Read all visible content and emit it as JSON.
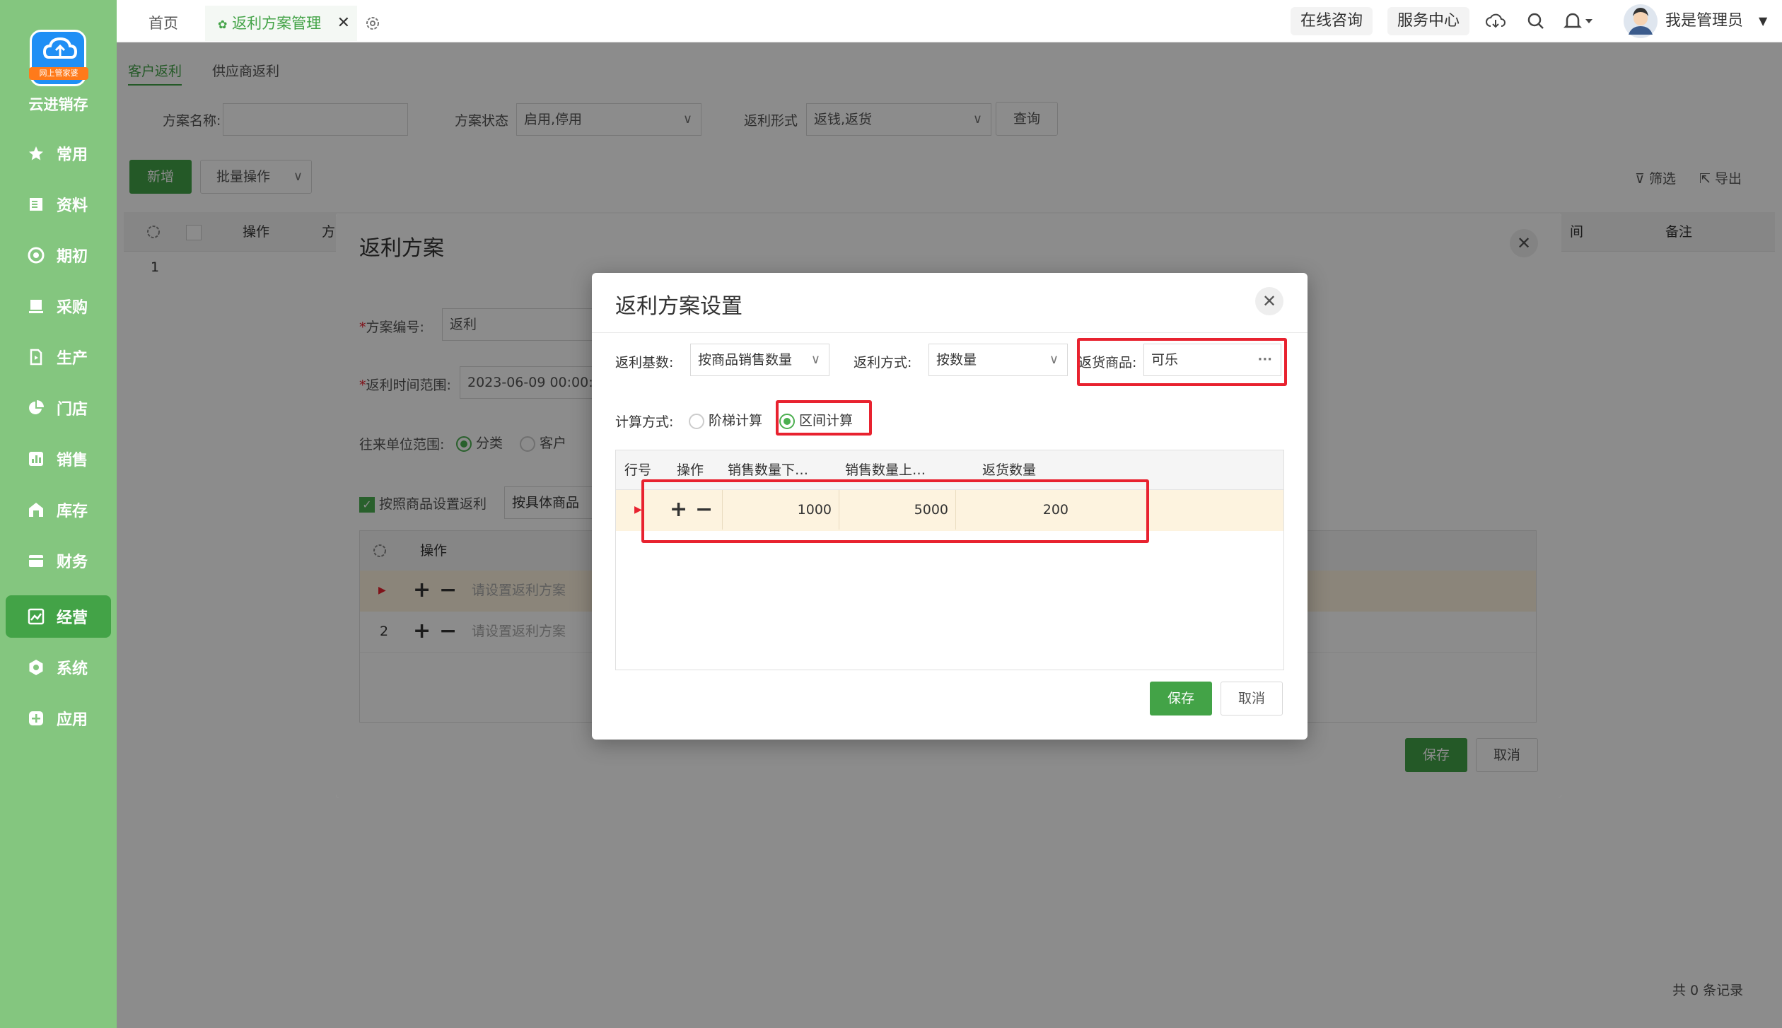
{
  "app": {
    "name": "云进销存",
    "logo_tag": "网上管家婆"
  },
  "sidebar": {
    "items": [
      {
        "label": "常用",
        "icon": "star-icon"
      },
      {
        "label": "资料",
        "icon": "document-icon"
      },
      {
        "label": "期初",
        "icon": "target-icon"
      },
      {
        "label": "采购",
        "icon": "purchase-icon"
      },
      {
        "label": "生产",
        "icon": "production-icon"
      },
      {
        "label": "门店",
        "icon": "pie-icon"
      },
      {
        "label": "销售",
        "icon": "bar-chart-icon"
      },
      {
        "label": "库存",
        "icon": "warehouse-icon"
      },
      {
        "label": "财务",
        "icon": "wallet-icon"
      },
      {
        "label": "经营",
        "icon": "trend-icon",
        "active": true
      },
      {
        "label": "系统",
        "icon": "settings-icon"
      },
      {
        "label": "应用",
        "icon": "plus-icon"
      }
    ]
  },
  "topbar": {
    "home": "首页",
    "active_tab": "返利方案管理",
    "online": "在线咨询",
    "service": "服务中心",
    "user": "我是管理员"
  },
  "page": {
    "subtabs": [
      "客户返利",
      "供应商返利"
    ],
    "filters": {
      "name_label": "方案名称:",
      "status_label": "方案状态",
      "status_value": "启用,停用",
      "form_label": "返利形式",
      "form_value": "返钱,返货",
      "query": "查询"
    },
    "toolbar": {
      "add": "新增",
      "batch": "批量操作",
      "filter": "筛选",
      "export": "导出"
    },
    "table": {
      "headers": [
        "操作",
        "方",
        "间",
        "备注"
      ],
      "row1": "1"
    },
    "footer": "共 0 条记录"
  },
  "dialog_outer": {
    "title": "返利方案",
    "code_label": "方案编号:",
    "code_value": "返利",
    "time_label": "返利时间范围:",
    "time_value": "2023-06-09 00:00:0",
    "scope_label": "往来单位范围:",
    "scope_opt1": "分类",
    "scope_opt2": "客户",
    "by_goods": "按照商品设置返利",
    "by_specific": "按具体商品",
    "grid_header": "操作",
    "rows": [
      {
        "no": "▶",
        "placeholder": "请设置返利方案"
      },
      {
        "no": "2",
        "placeholder": "请设置返利方案"
      }
    ],
    "save": "保存",
    "cancel": "取消"
  },
  "dialog_inner": {
    "title": "返利方案设置",
    "base_label": "返利基数:",
    "base_value": "按商品销售数量",
    "method_label": "返利方式:",
    "method_value": "按数量",
    "goods_label": "返货商品:",
    "goods_value": "可乐",
    "calc_label": "计算方式:",
    "calc_opt1": "阶梯计算",
    "calc_opt2": "区间计算",
    "headers": [
      "行号",
      "操作",
      "销售数量下…",
      "销售数量上…",
      "返货数量"
    ],
    "row": {
      "lower": "1000",
      "upper": "5000",
      "qty": "200"
    },
    "save": "保存",
    "cancel": "取消"
  },
  "colors": {
    "sidebar": "#84c67f",
    "accent": "#43a347",
    "highlight": "#e8222f"
  }
}
